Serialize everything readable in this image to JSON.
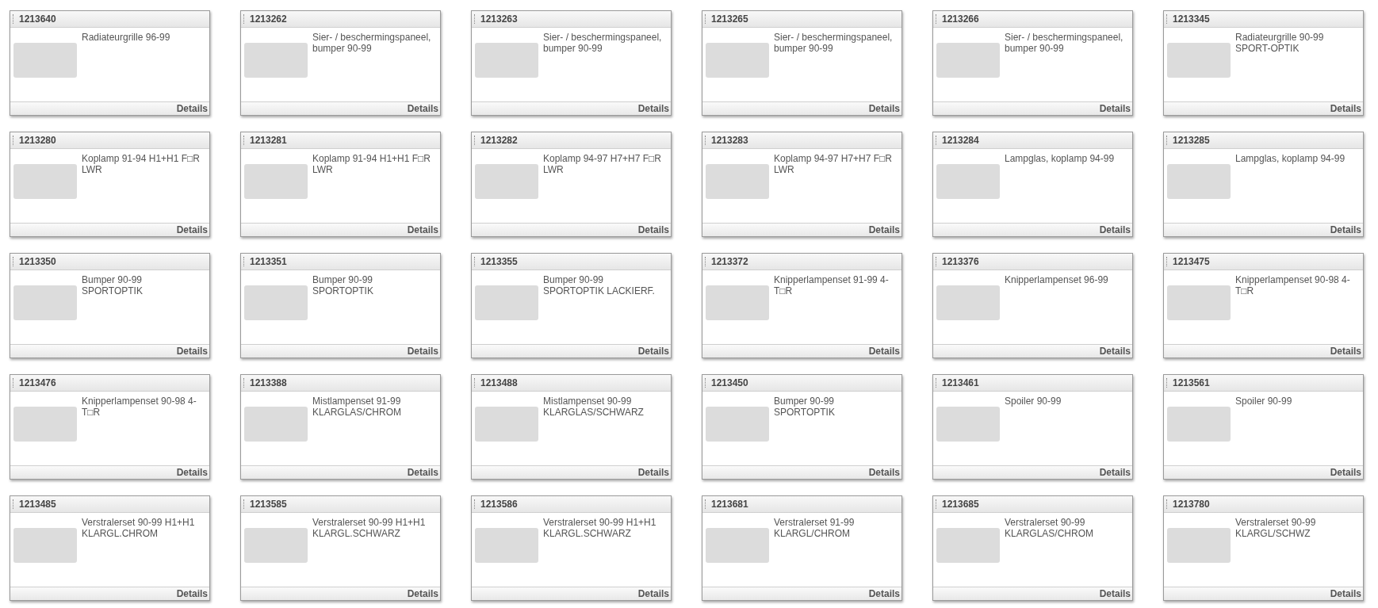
{
  "products": [
    {
      "number": "1213640",
      "name": "Radiateurgrille 96-99",
      "link": "Details"
    },
    {
      "number": "1213262",
      "name": "Sier- / beschermingspaneel, bumper 90-99",
      "link": "Details"
    },
    {
      "number": "1213263",
      "name": "Sier- / beschermingspaneel, bumper 90-99",
      "link": "Details"
    },
    {
      "number": "1213265",
      "name": "Sier- / beschermingspaneel, bumper 90-99",
      "link": "Details"
    },
    {
      "number": "1213266",
      "name": "Sier- / beschermingspaneel, bumper 90-99",
      "link": "Details"
    },
    {
      "number": "1213345",
      "name": "Radiateurgrille 90-99 SPORT-OPTIK",
      "link": "Details"
    },
    {
      "number": "1213280",
      "name": "Koplamp 91-94 H1+H1 F□R LWR",
      "link": "Details"
    },
    {
      "number": "1213281",
      "name": "Koplamp 91-94 H1+H1 F□R LWR",
      "link": "Details"
    },
    {
      "number": "1213282",
      "name": "Koplamp 94-97 H7+H7 F□R LWR",
      "link": "Details"
    },
    {
      "number": "1213283",
      "name": "Koplamp 94-97 H7+H7 F□R LWR",
      "link": "Details"
    },
    {
      "number": "1213284",
      "name": "Lampglas, koplamp 94-99",
      "link": "Details"
    },
    {
      "number": "1213285",
      "name": "Lampglas, koplamp 94-99",
      "link": "Details"
    },
    {
      "number": "1213350",
      "name": "Bumper 90-99 SPORTOPTIK",
      "link": "Details"
    },
    {
      "number": "1213351",
      "name": "Bumper 90-99 SPORTOPTIK",
      "link": "Details"
    },
    {
      "number": "1213355",
      "name": "Bumper 90-99 SPORTOPTIK LACKIERF.",
      "link": "Details"
    },
    {
      "number": "1213372",
      "name": "Knipperlampenset 91-99 4-T□R",
      "link": "Details"
    },
    {
      "number": "1213376",
      "name": "Knipperlampenset 96-99",
      "link": "Details"
    },
    {
      "number": "1213475",
      "name": "Knipperlampenset 90-98 4-T□R",
      "link": "Details"
    },
    {
      "number": "1213476",
      "name": "Knipperlampenset 90-98 4-T□R",
      "link": "Details"
    },
    {
      "number": "1213388",
      "name": "Mistlampenset 91-99 KLARGLAS/CHROM",
      "link": "Details"
    },
    {
      "number": "1213488",
      "name": "Mistlampenset 90-99 KLARGLAS/SCHWARZ",
      "link": "Details"
    },
    {
      "number": "1213450",
      "name": "Bumper 90-99 SPORTOPTIK",
      "link": "Details"
    },
    {
      "number": "1213461",
      "name": "Spoiler 90-99",
      "link": "Details"
    },
    {
      "number": "1213561",
      "name": "Spoiler 90-99",
      "link": "Details"
    },
    {
      "number": "1213485",
      "name": "Verstralerset 90-99 H1+H1 KLARGL.CHROM",
      "link": "Details"
    },
    {
      "number": "1213585",
      "name": "Verstralerset 90-99 H1+H1 KLARGL.SCHWARZ",
      "link": "Details"
    },
    {
      "number": "1213586",
      "name": "Verstralerset 90-99 H1+H1 KLARGL.SCHWARZ",
      "link": "Details"
    },
    {
      "number": "1213681",
      "name": "Verstralerset 91-99 KLARGL/CHROM",
      "link": "Details"
    },
    {
      "number": "1213685",
      "name": "Verstralerset 90-99 KLARGLAS/CHROM",
      "link": "Details"
    },
    {
      "number": "1213780",
      "name": "Verstralerset 90-99 KLARGL/SCHWZ",
      "link": "Details"
    }
  ]
}
